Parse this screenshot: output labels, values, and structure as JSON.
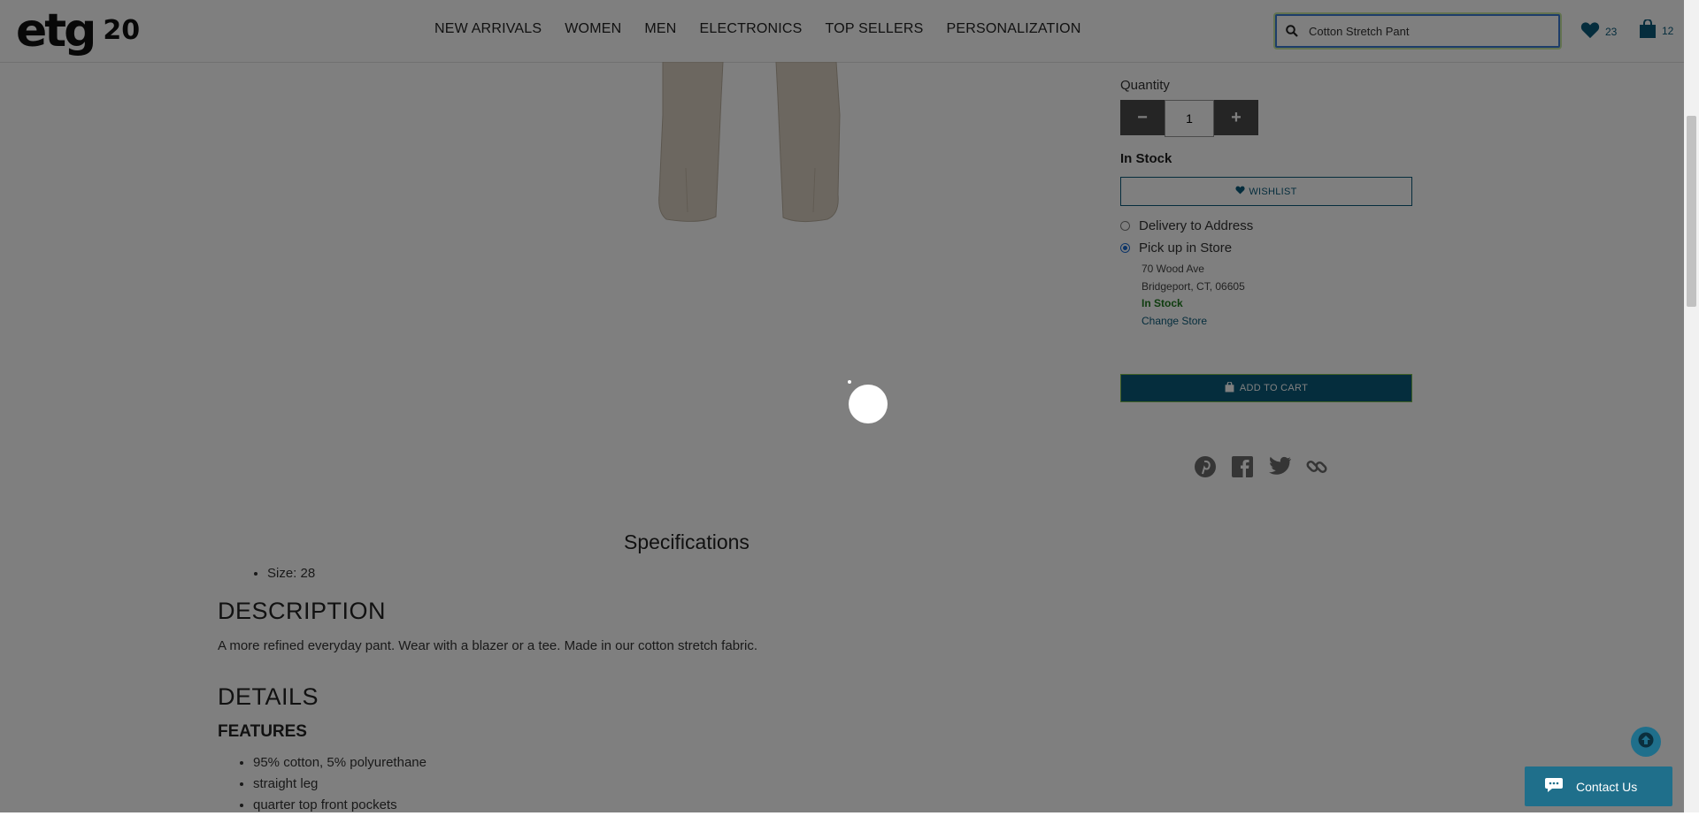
{
  "header": {
    "logo_main": "etg",
    "logo_suffix": "20",
    "nav": [
      "NEW ARRIVALS",
      "WOMEN",
      "MEN",
      "ELECTRONICS",
      "TOP SELLERS",
      "PERSONALIZATION"
    ],
    "search_value": "Cotton Stretch Pant",
    "wishlist_count": "23",
    "cart_count": "12"
  },
  "product": {
    "quantity_label": "Quantity",
    "quantity_value": "1",
    "stock_status": "In Stock",
    "wishlist_button": "WISHLIST",
    "delivery_option": "Delivery to Address",
    "pickup_option": "Pick up in Store",
    "store_address_line1": "70 Wood Ave",
    "store_address_line2": "Bridgeport, CT, 06605",
    "store_stock": "In Stock",
    "change_store": "Change Store",
    "add_to_cart": "ADD TO CART",
    "social_icons": [
      "pinterest-icon",
      "facebook-icon",
      "twitter-icon",
      "link-icon"
    ]
  },
  "specs": {
    "title": "Specifications",
    "items": [
      "Size: 28"
    ]
  },
  "description": {
    "heading": "DESCRIPTION",
    "text": "A more refined everyday pant. Wear with a blazer or a tee. Made in our cotton stretch fabric."
  },
  "details": {
    "heading": "DETAILS",
    "features_heading": "FEATURES",
    "features": [
      "95% cotton, 5% polyurethane",
      "straight leg",
      "quarter top front pockets"
    ]
  },
  "chat": {
    "label": "Contact Us"
  },
  "colors": {
    "brand": "#0a5a7a",
    "overlay": "rgba(0,0,0,0.5)"
  }
}
